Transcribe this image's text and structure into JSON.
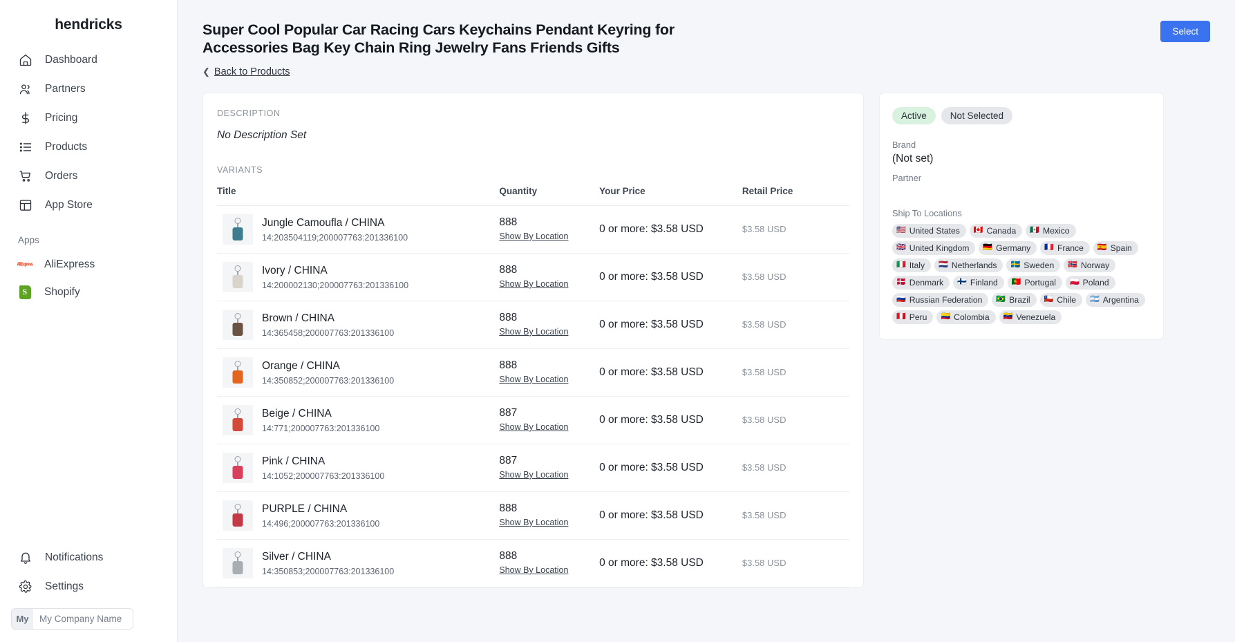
{
  "sidebar": {
    "brand": "hendricks",
    "items": [
      {
        "label": "Dashboard",
        "icon": "home-icon"
      },
      {
        "label": "Partners",
        "icon": "users-icon"
      },
      {
        "label": "Pricing",
        "icon": "dollar-icon"
      },
      {
        "label": "Products",
        "icon": "list-icon"
      },
      {
        "label": "Orders",
        "icon": "cart-icon"
      },
      {
        "label": "App Store",
        "icon": "layout-icon"
      }
    ],
    "apps_heading": "Apps",
    "apps": [
      {
        "label": "AliExpress",
        "icon": "aliexpress-icon",
        "mark": "AliExpress"
      },
      {
        "label": "Shopify",
        "icon": "shopify-icon"
      }
    ],
    "bottom": [
      {
        "label": "Notifications",
        "icon": "bell-icon"
      },
      {
        "label": "Settings",
        "icon": "gear-icon"
      }
    ],
    "company": {
      "avatar": "My",
      "name": "My Company Name"
    }
  },
  "header": {
    "title": "Super Cool Popular Car Racing Cars Keychains Pendant Keyring for Accessories Bag Key Chain Ring Jewelry Fans Friends Gifts",
    "back_label": "Back to Products",
    "back_icon": "chevron-left-icon",
    "select_label": "Select",
    "accent_color": "#3b72ef"
  },
  "details": {
    "description_label": "DESCRIPTION",
    "description_value": "No Description Set",
    "variants_label": "VARIANTS",
    "columns": [
      "Title",
      "Quantity",
      "Your Price",
      "Retail Price"
    ],
    "show_by_location_label": "Show By Location",
    "rows": [
      {
        "title": "Jungle Camoufla / CHINA",
        "sku": "14:203504119;200007763:201336100",
        "qty": "888",
        "your_price": "0 or more: $3.58 USD",
        "retail_price": "$3.58 USD",
        "swatch": "#3e7c8e"
      },
      {
        "title": "Ivory / CHINA",
        "sku": "14:200002130;200007763:201336100",
        "qty": "888",
        "your_price": "0 or more: $3.58 USD",
        "retail_price": "$3.58 USD",
        "swatch": "#d8d4cb"
      },
      {
        "title": "Brown / CHINA",
        "sku": "14:365458;200007763:201336100",
        "qty": "888",
        "your_price": "0 or more: $3.58 USD",
        "retail_price": "$3.58 USD",
        "swatch": "#6b5344"
      },
      {
        "title": "Orange / CHINA",
        "sku": "14:350852;200007763:201336100",
        "qty": "888",
        "your_price": "0 or more: $3.58 USD",
        "retail_price": "$3.58 USD",
        "swatch": "#e2661f"
      },
      {
        "title": "Beige / CHINA",
        "sku": "14:771;200007763:201336100",
        "qty": "887",
        "your_price": "0 or more: $3.58 USD",
        "retail_price": "$3.58 USD",
        "swatch": "#d24a3a"
      },
      {
        "title": "Pink / CHINA",
        "sku": "14:1052;200007763:201336100",
        "qty": "887",
        "your_price": "0 or more: $3.58 USD",
        "retail_price": "$3.58 USD",
        "swatch": "#d8415e"
      },
      {
        "title": "PURPLE / CHINA",
        "sku": "14:496;200007763:201336100",
        "qty": "888",
        "your_price": "0 or more: $3.58 USD",
        "retail_price": "$3.58 USD",
        "swatch": "#c23a46"
      },
      {
        "title": "Silver / CHINA",
        "sku": "14:350853;200007763:201336100",
        "qty": "888",
        "your_price": "0 or more: $3.58 USD",
        "retail_price": "$3.58 USD",
        "swatch": "#a9aeb4"
      }
    ]
  },
  "info": {
    "status_badge": "Active",
    "selection_badge": "Not Selected",
    "status_color": "#d9f2df",
    "brand_label": "Brand",
    "brand_value": "(Not set)",
    "partner_label": "Partner",
    "partner_value": "",
    "ship_label": "Ship To Locations",
    "locations": [
      {
        "name": "United States",
        "flag": "🇺🇸"
      },
      {
        "name": "Canada",
        "flag": "🇨🇦"
      },
      {
        "name": "Mexico",
        "flag": "🇲🇽"
      },
      {
        "name": "United Kingdom",
        "flag": "🇬🇧"
      },
      {
        "name": "Germany",
        "flag": "🇩🇪"
      },
      {
        "name": "France",
        "flag": "🇫🇷"
      },
      {
        "name": "Spain",
        "flag": "🇪🇸"
      },
      {
        "name": "Italy",
        "flag": "🇮🇹"
      },
      {
        "name": "Netherlands",
        "flag": "🇳🇱"
      },
      {
        "name": "Sweden",
        "flag": "🇸🇪"
      },
      {
        "name": "Norway",
        "flag": "🇳🇴"
      },
      {
        "name": "Denmark",
        "flag": "🇩🇰"
      },
      {
        "name": "Finland",
        "flag": "🇫🇮"
      },
      {
        "name": "Portugal",
        "flag": "🇵🇹"
      },
      {
        "name": "Poland",
        "flag": "🇵🇱"
      },
      {
        "name": "Russian Federation",
        "flag": "🇷🇺"
      },
      {
        "name": "Brazil",
        "flag": "🇧🇷"
      },
      {
        "name": "Chile",
        "flag": "🇨🇱"
      },
      {
        "name": "Argentina",
        "flag": "🇦🇷"
      },
      {
        "name": "Peru",
        "flag": "🇵🇪"
      },
      {
        "name": "Colombia",
        "flag": "🇨🇴"
      },
      {
        "name": "Venezuela",
        "flag": "🇻🇪"
      }
    ]
  }
}
